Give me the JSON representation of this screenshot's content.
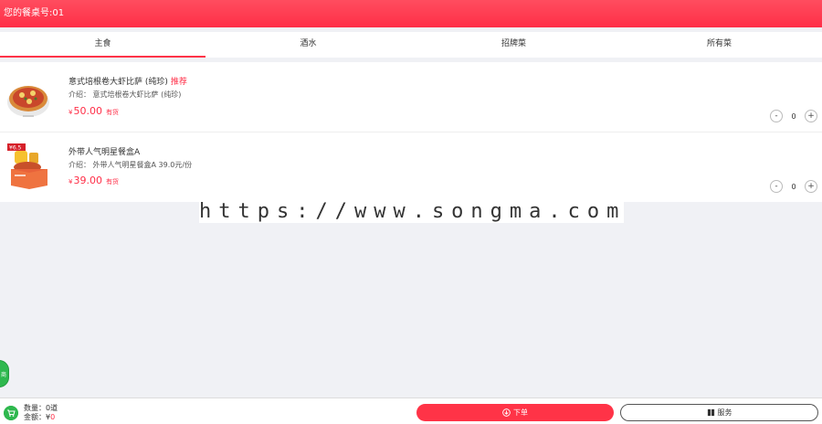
{
  "header": {
    "title": "您的餐桌号:01"
  },
  "tabs": [
    {
      "label": "主食"
    },
    {
      "label": "酒水"
    },
    {
      "label": "招牌菜"
    },
    {
      "label": "所有菜"
    }
  ],
  "items": [
    {
      "name": "意式培根卷大虾比萨 (纯珍)",
      "tag": "推荐",
      "desc": "介绍： 意式培根卷大虾比萨 (纯珍)",
      "currency": "¥",
      "price": "50.00",
      "stock": "有货",
      "qty": "0"
    },
    {
      "name": "外带人气明星餐盒A",
      "badge": "¥6.5",
      "desc": "介绍： 外带人气明星餐盒A 39.0元/份",
      "currency": "¥",
      "price": "39.00",
      "stock": "有货",
      "qty": "0"
    }
  ],
  "stepper": {
    "minus": "-",
    "plus": "+"
  },
  "watermark": "https://www.songma.com",
  "float_button": {
    "label": "商"
  },
  "footer": {
    "count_label": "数量：",
    "count_value": "0",
    "count_unit": "道",
    "amount_label": "金额：",
    "amount_currency": "¥",
    "amount_value": "0",
    "order_label": "下单",
    "service_label": "服务"
  },
  "colors": {
    "accent": "#ff3347",
    "green": "#2eb84e"
  },
  "icons": [
    "shopping-cart-icon",
    "order-icon",
    "service-icon"
  ]
}
